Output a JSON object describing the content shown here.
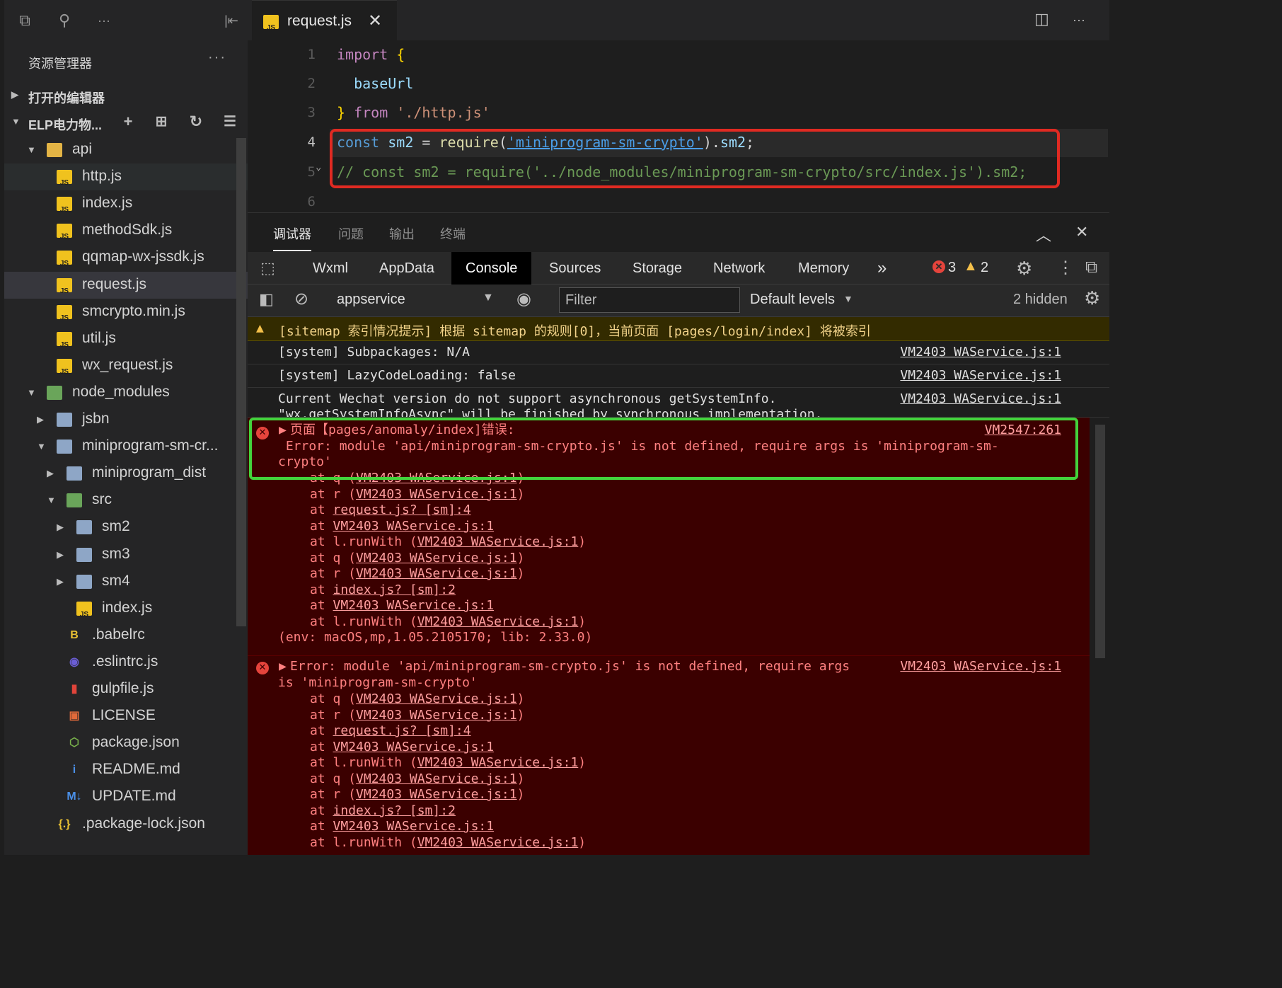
{
  "sidebar": {
    "title": "资源管理器",
    "more": "···",
    "open_editors": "打开的编辑器",
    "project": "ELP电力物...",
    "tree": [
      {
        "name": "api",
        "type": "folder-y",
        "depth": 1,
        "open": true
      },
      {
        "name": "http.js",
        "type": "js",
        "depth": 2
      },
      {
        "name": "index.js",
        "type": "js",
        "depth": 2
      },
      {
        "name": "methodSdk.js",
        "type": "js",
        "depth": 2
      },
      {
        "name": "qqmap-wx-jssdk.js",
        "type": "js",
        "depth": 2
      },
      {
        "name": "request.js",
        "type": "js",
        "depth": 2,
        "selected": true
      },
      {
        "name": "smcrypto.min.js",
        "type": "js",
        "depth": 2
      },
      {
        "name": "util.js",
        "type": "js",
        "depth": 2
      },
      {
        "name": "wx_request.js",
        "type": "js",
        "depth": 2
      },
      {
        "name": "node_modules",
        "type": "folder-g",
        "depth": 1,
        "open": true
      },
      {
        "name": "jsbn",
        "type": "folder",
        "depth": 2,
        "closed": true
      },
      {
        "name": "miniprogram-sm-cr...",
        "type": "folder",
        "depth": 2,
        "open": true
      },
      {
        "name": "miniprogram_dist",
        "type": "folder",
        "depth": 3,
        "closed": true
      },
      {
        "name": "src",
        "type": "folder-g",
        "depth": 3,
        "open": true
      },
      {
        "name": "sm2",
        "type": "folder",
        "depth": 4,
        "closed": true
      },
      {
        "name": "sm3",
        "type": "folder",
        "depth": 4,
        "closed": true
      },
      {
        "name": "sm4",
        "type": "folder",
        "depth": 4,
        "closed": true
      },
      {
        "name": "index.js",
        "type": "js",
        "depth": 4
      },
      {
        "name": ".babelrc",
        "type": "babel",
        "depth": 3
      },
      {
        "name": ".eslintrc.js",
        "type": "eslint",
        "depth": 3
      },
      {
        "name": "gulpfile.js",
        "type": "gulp",
        "depth": 3
      },
      {
        "name": "LICENSE",
        "type": "license",
        "depth": 3
      },
      {
        "name": "package.json",
        "type": "npm",
        "depth": 3
      },
      {
        "name": "README.md",
        "type": "info",
        "depth": 3
      },
      {
        "name": "UPDATE.md",
        "type": "md",
        "depth": 3
      },
      {
        "name": ".package-lock.json",
        "type": "json",
        "depth": 2
      }
    ]
  },
  "tab": {
    "name": "request.js",
    "close": "✕"
  },
  "editor": {
    "lines": [
      "1",
      "2",
      "3",
      "4",
      "5",
      "6"
    ]
  },
  "panel": {
    "tabs": [
      "调试器",
      "问题",
      "输出",
      "终端"
    ],
    "devtabs": [
      "Wxml",
      "AppData",
      "Console",
      "Sources",
      "Storage",
      "Network",
      "Memory"
    ],
    "more": "»",
    "errors": "3",
    "warnings": "2",
    "context": "appservice",
    "filter_placeholder": "Filter",
    "levels": "Default levels",
    "hidden": "2 hidden"
  },
  "console": {
    "warn": "[sitemap 索引情况提示] 根据 sitemap 的规则[0]，当前页面 [pages/login/index] 将被索引",
    "rows": [
      {
        "msg": "[system] Subpackages: N/A",
        "src": "VM2403 WAService.js:1"
      },
      {
        "msg": "[system] LazyCodeLoading: false",
        "src": "VM2403 WAService.js:1"
      },
      {
        "msg": "Current Wechat version do not support asynchronous getSystemInfo.",
        "msg2": "\"wx.getSystemInfoAsync\" will be finished by synchronous implementation.",
        "src": "VM2403 WAService.js:1"
      }
    ],
    "err1": {
      "title": "页面【pages/anomaly/index]错误:",
      "src": "VM2547:261",
      "line1": " Error: module 'api/miniprogram-sm-crypto.js' is not defined, require args is 'miniprogram-sm-",
      "line2": "crypto'",
      "env": "(env: macOS,mp,1.05.2105170; lib: 2.33.0)"
    },
    "err2": {
      "title": "Error: module 'api/miniprogram-sm-crypto.js' is not defined, require args",
      "line2": "is 'miniprogram-sm-crypto'",
      "src": "VM2403 WAService.js:1"
    },
    "stack1": [
      [
        "at q (",
        "VM2403 WAService.js:1",
        ")"
      ],
      [
        "at r (",
        "VM2403 WAService.js:1",
        ")"
      ],
      [
        "at ",
        "request.js? [sm]:4",
        ""
      ],
      [
        "at ",
        "VM2403 WAService.js:1",
        ""
      ],
      [
        "at l.runWith (",
        "VM2403 WAService.js:1",
        ")"
      ],
      [
        "at q (",
        "VM2403 WAService.js:1",
        ")"
      ],
      [
        "at r (",
        "VM2403 WAService.js:1",
        ")"
      ],
      [
        "at ",
        "index.js? [sm]:2",
        ""
      ],
      [
        "at ",
        "VM2403 WAService.js:1",
        ""
      ],
      [
        "at l.runWith (",
        "VM2403 WAService.js:1",
        ")"
      ]
    ]
  },
  "colors": {
    "error_bg": "#3b0000",
    "warn_bg": "#332b00",
    "annot_red": "#e02a22",
    "annot_green": "#43d33c"
  }
}
